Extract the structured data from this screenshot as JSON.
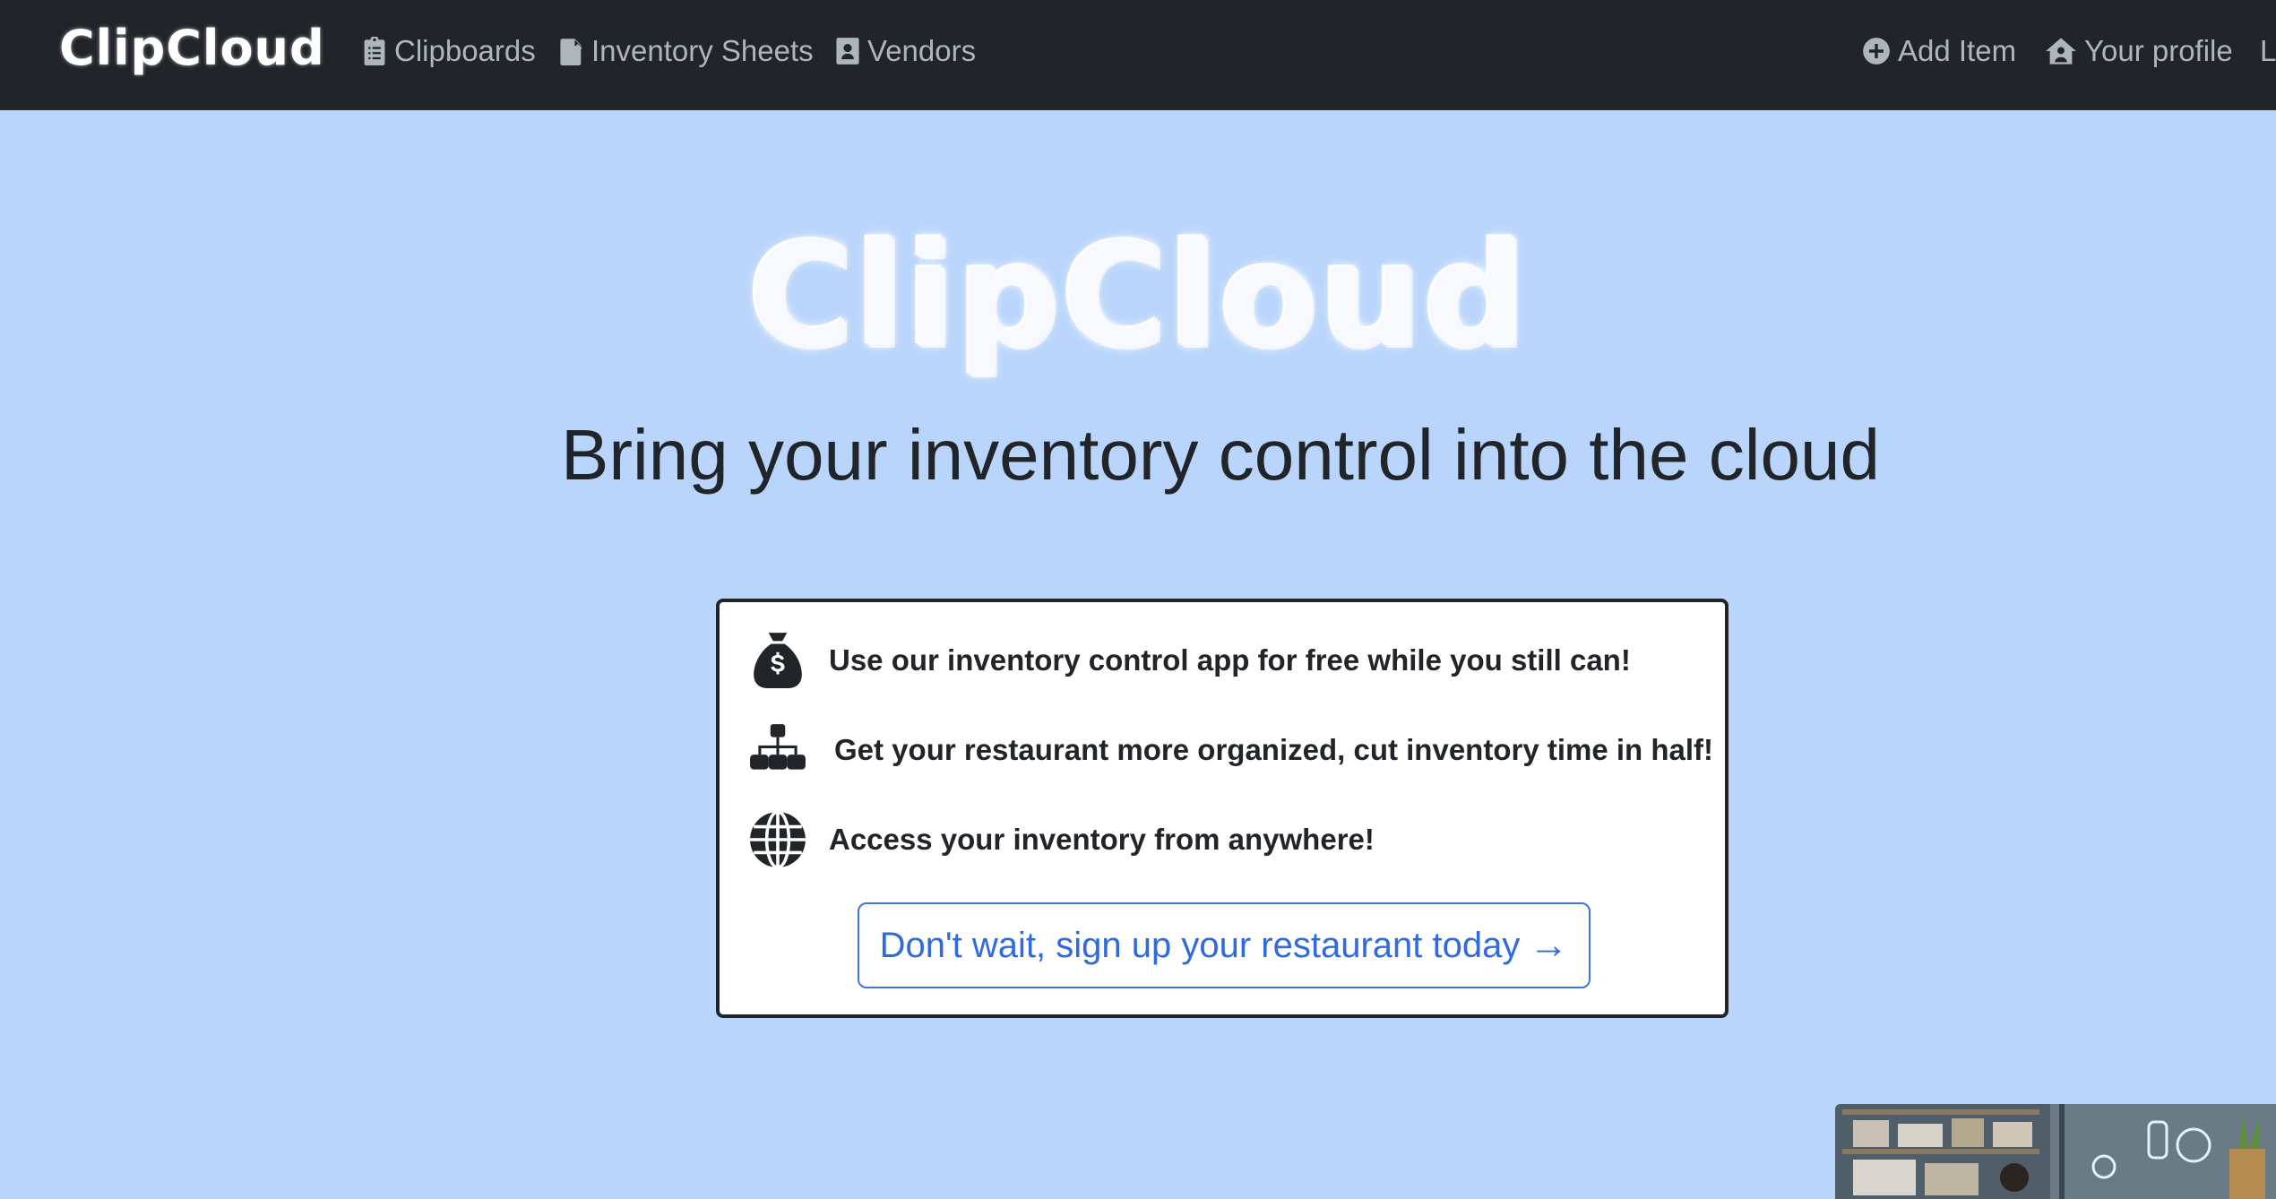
{
  "navbar": {
    "brand": "ClipCloud",
    "links": [
      {
        "label": "Clipboards",
        "icon": "clipboard-icon"
      },
      {
        "label": "Inventory Sheets",
        "icon": "file-icon"
      },
      {
        "label": "Vendors",
        "icon": "contact-book-icon"
      }
    ],
    "right_links": [
      {
        "label": "Add Item",
        "icon": "plus-circle-icon"
      },
      {
        "label": "Your profile",
        "icon": "house-user-icon"
      },
      {
        "label": "L"
      }
    ]
  },
  "hero": {
    "logo": "ClipCloud",
    "tagline": "Bring your inventory control into the cloud"
  },
  "features": [
    {
      "text": "Use our inventory control app for free while you still can!",
      "icon": "money-bag-icon"
    },
    {
      "text": "Get your restaurant more organized, cut inventory time in half!",
      "icon": "sitemap-icon"
    },
    {
      "text": "Access your inventory from anywhere!",
      "icon": "globe-icon"
    }
  ],
  "cta": {
    "label": "Don't wait, sign up your restaurant today",
    "arrow": "→"
  },
  "colors": {
    "navbar_bg": "#212529",
    "page_bg": "#b9d5fb",
    "link_blue": "#2f6ae0"
  }
}
